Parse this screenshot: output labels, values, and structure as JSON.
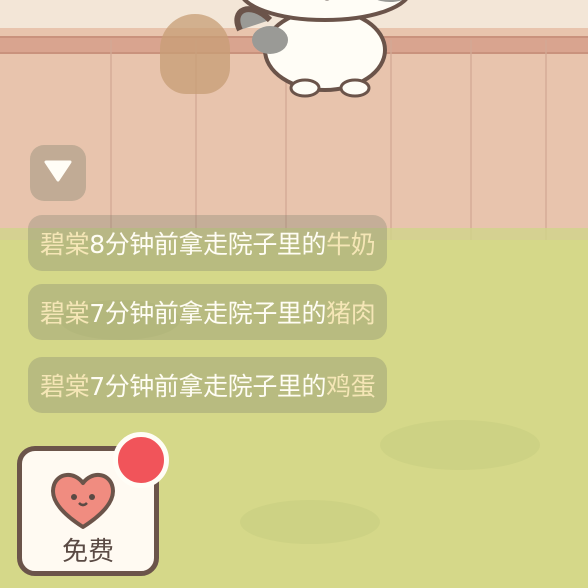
{
  "scene": {
    "name": "courtyard",
    "colors": {
      "fence": "#e8c4ad",
      "grass": "#d5d889",
      "accent_red": "#f1545a"
    }
  },
  "activity_feed": [
    {
      "who": "碧棠",
      "time": "8分钟前",
      "action": "拿走院子里的",
      "item": "牛奶"
    },
    {
      "who": "碧棠",
      "time": "7分钟前",
      "action": "拿走院子里的",
      "item": "猪肉"
    },
    {
      "who": "碧棠",
      "time": "7分钟前",
      "action": "拿走院子里的",
      "item": "鸡蛋"
    }
  ],
  "free_button": {
    "label": "免费",
    "icon": "heart-face-icon",
    "badge": "red-dot"
  },
  "collapse_button": {
    "icon": "triangle-down-icon"
  }
}
